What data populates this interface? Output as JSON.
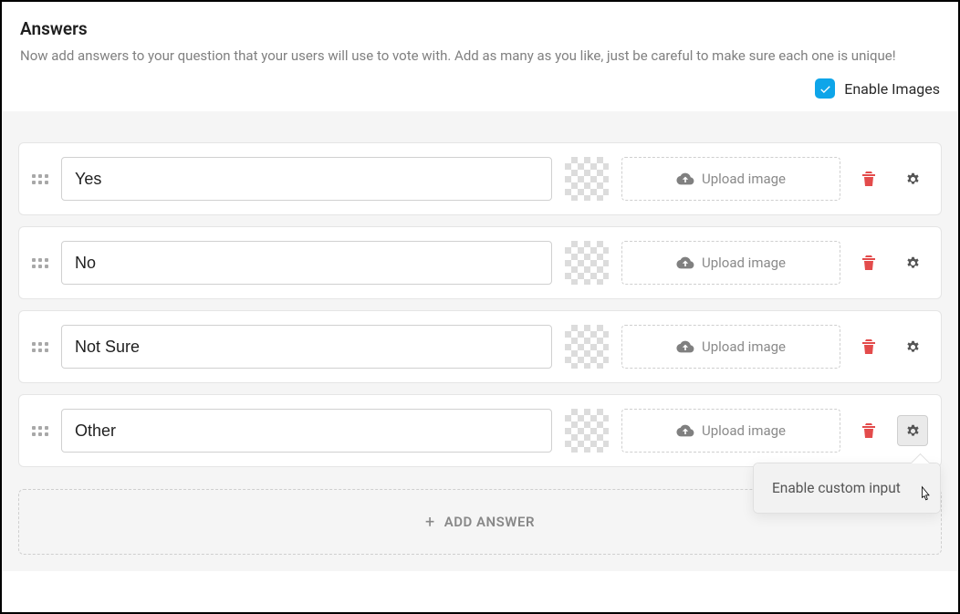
{
  "header": {
    "title": "Answers",
    "subtitle": "Now add answers to your question that your users will use to vote with. Add as many as you like, just be careful to make sure each one is unique!"
  },
  "enableImages": {
    "label": "Enable Images",
    "checked": true
  },
  "uploadLabel": "Upload image",
  "answers": [
    {
      "value": "Yes"
    },
    {
      "value": "No"
    },
    {
      "value": "Not Sure"
    },
    {
      "value": "Other"
    }
  ],
  "popover": {
    "item": "Enable custom input"
  },
  "addAnswer": {
    "label": "ADD ANSWER"
  }
}
